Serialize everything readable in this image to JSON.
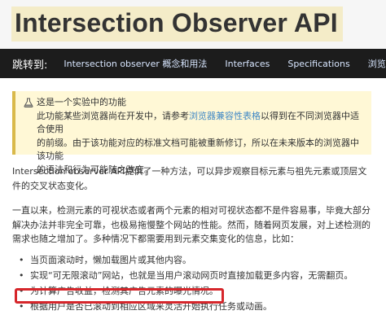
{
  "header": {
    "title": "Intersection Observer API"
  },
  "jumpbar": {
    "label": "跳转到:",
    "links": [
      "Intersection observer 概念和用法",
      "Interfaces",
      "Specifications",
      "浏览器兼容性"
    ]
  },
  "warning": {
    "icon": "flask-icon",
    "title": "这是一个实验中的功能",
    "line1_pre": "此功能某些浏览器尚在开发中，请参考",
    "line1_link": "浏览器兼容性表格",
    "line1_post": "以得到在不同浏览器中适合使用",
    "line2": "的前缀。由于该功能对应的标准文档可能被重新修订，所以在未来版本的浏览器中该功能",
    "line3": "的语法和行为可能随之改变。"
  },
  "content": {
    "para1": "Intersection observer API提供了一种方法，可以异步观察目标元素与祖先元素或顶层文件的交叉状态变化。",
    "para2": "一直以来，检测元素的可视状态或者两个元素的相对可视状态都不是件容易事，毕竟大部分解决办法并非完全可靠，也极易拖慢整个网站的性能。然而，随着网页发展，对上述检测的需求也随之增加了。多种情况下都需要用到元素交集变化的信息，比如：",
    "bullets": [
      "当页面滚动时，懒加载图片或其他内容。",
      "实现“可无限滚动”网站，也就是当用户滚动网页时直接加载更多内容，无需翻页。",
      "为计算广告收益，检测其广告元素的曝光情况。",
      "根据用户是否已滚动到相应区域来灵活开始执行任务或动画。"
    ]
  },
  "colors": {
    "highlight": "#d6262b",
    "link": "#3f87c5",
    "jumpbar": "#1c1c1c"
  }
}
